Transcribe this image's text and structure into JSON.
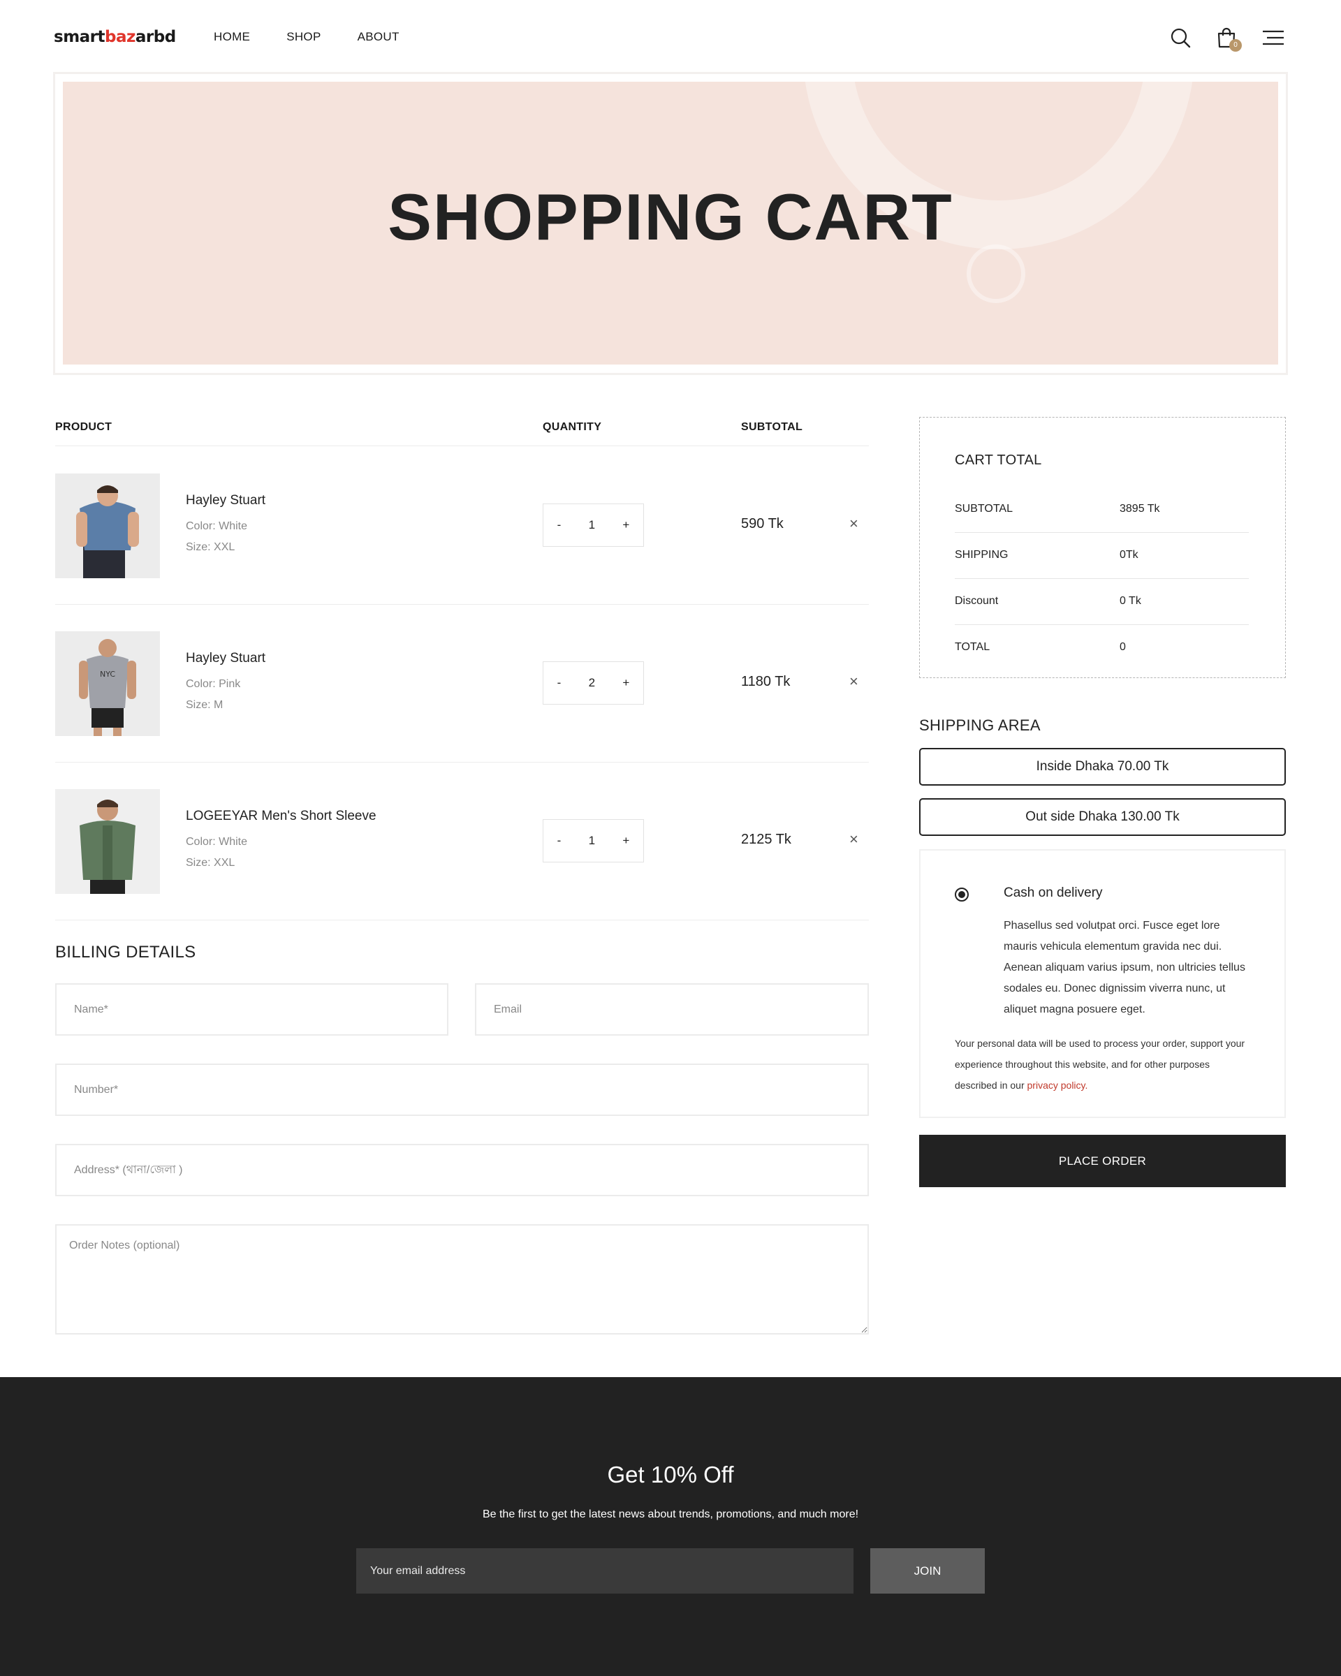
{
  "header": {
    "logo_prefix": "smart",
    "logo_accent": "baz",
    "logo_suffix": "arbd",
    "nav": [
      "HOME",
      "SHOP",
      "ABOUT"
    ],
    "cart_count": "0",
    "icons": [
      "search-icon",
      "cart-icon",
      "menu-icon"
    ]
  },
  "banner": {
    "title": "SHOPPING CART"
  },
  "cart": {
    "headers": {
      "product": "PRODUCT",
      "quantity": "QUANTITY",
      "subtotal": "SUBTOTAL"
    },
    "items": [
      {
        "name": "Hayley Stuart",
        "color": "Color: White",
        "size": "Size: XXL",
        "qty": "1",
        "subtotal": "590 Tk"
      },
      {
        "name": "Hayley Stuart",
        "color": "Color: Pink",
        "size": "Size: M",
        "qty": "2",
        "subtotal": "1180 Tk"
      },
      {
        "name": "LOGEEYAR Men's Short Sleeve",
        "color": "Color: White",
        "size": "Size: XXL",
        "qty": "1",
        "subtotal": "2125 Tk"
      }
    ],
    "minus": "-",
    "plus": "+",
    "remove": "×"
  },
  "billing": {
    "title": "BILLING DETAILS",
    "name_placeholder": "Name*",
    "email_placeholder": "Email",
    "number_placeholder": "Number*",
    "address_placeholder": "Address* (থানা/জেলা )",
    "notes_placeholder": "Order Notes (optional)"
  },
  "totals": {
    "title": "CART TOTAL",
    "rows": [
      {
        "label": "SUBTOTAL",
        "value": "3895 Tk"
      },
      {
        "label": "SHIPPING",
        "value": "0Tk"
      },
      {
        "label": "Discount",
        "value": "0 Tk"
      },
      {
        "label": "TOTAL",
        "value": "0"
      }
    ]
  },
  "shipping": {
    "title": "SHIPPING AREA",
    "options": [
      "Inside Dhaka 70.00 Tk",
      "Out side Dhaka 130.00 Tk"
    ]
  },
  "payment": {
    "label": "Cash on delivery",
    "description": "Phasellus sed volutpat orci. Fusce eget lore mauris vehicula elementum gravida nec dui. Aenean aliquam varius ipsum, non ultricies tellus sodales eu. Donec dignissim viverra nunc, ut aliquet magna posuere eget.",
    "privacy_text": "Your personal data will be used to process your order, support your experience throughout this website, and for other purposes described in our ",
    "privacy_link": "privacy policy."
  },
  "place_order": "PLACE ORDER",
  "footer": {
    "title": "Get 10% Off",
    "subtitle": "Be the first to get the latest news about trends, promotions, and much more!",
    "email_placeholder": "Your email address",
    "join": "JOIN"
  },
  "colors": {
    "accent": "#e0352b",
    "banner": "#f5e3dc",
    "dark": "#222222",
    "badge": "#b9976a"
  }
}
